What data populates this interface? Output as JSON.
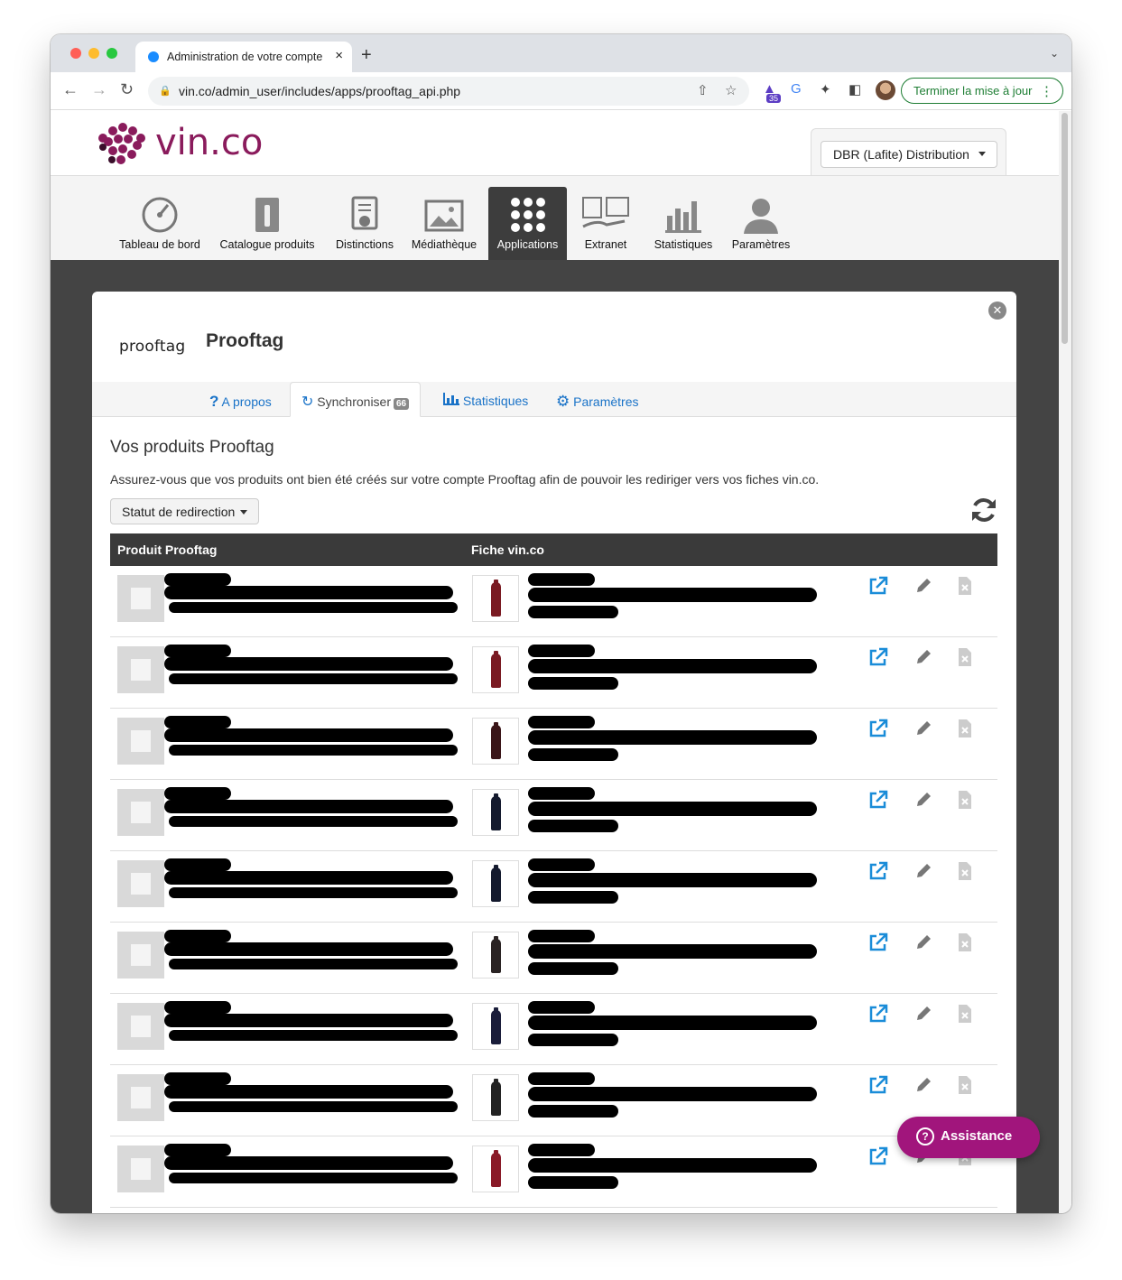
{
  "browser": {
    "tab_title": "Administration de votre compte",
    "url": "vin.co/admin_user/includes/apps/prooftag_api.php",
    "extension_badge": "35",
    "update_button": "Terminer la mise à jour"
  },
  "site": {
    "logo_text": "vin.co",
    "account_selector": "DBR (Lafite) Distribution"
  },
  "menu": {
    "items": [
      {
        "label": "Tableau de bord",
        "icon": "dashboard-icon"
      },
      {
        "label": "Catalogue produits",
        "icon": "catalog-icon"
      },
      {
        "label": "Distinctions",
        "icon": "certificate-icon"
      },
      {
        "label": "Médiathèque",
        "icon": "media-icon"
      },
      {
        "label": "Applications",
        "icon": "apps-icon",
        "active": true
      },
      {
        "label": "Extranet",
        "icon": "extranet-icon"
      },
      {
        "label": "Statistiques",
        "icon": "statistics-icon"
      },
      {
        "label": "Paramètres",
        "icon": "user-icon"
      }
    ]
  },
  "app": {
    "logo_text": "prooftag",
    "title": "Prooftag",
    "tabs": [
      {
        "label": "A propos",
        "icon": "question-icon"
      },
      {
        "label": "Synchroniser",
        "icon": "sync-icon",
        "badge": "66",
        "active": true
      },
      {
        "label": "Statistiques",
        "icon": "bar-chart-icon"
      },
      {
        "label": "Paramètres",
        "icon": "gear-icon"
      }
    ],
    "section_title": "Vos produits Prooftag",
    "description": "Assurez-vous que vos produits ont bien été créés sur votre compte Prooftag afin de pouvoir les rediriger vers vos fiches vin.co.",
    "filter_button": "Statut de redirection",
    "table": {
      "columns": [
        "Produit Prooftag",
        "Fiche vin.co"
      ],
      "rows": [
        {
          "bottle_color": "#7a1a22"
        },
        {
          "bottle_color": "#7a1a22"
        },
        {
          "bottle_color": "#3a1518"
        },
        {
          "bottle_color": "#141a2e"
        },
        {
          "bottle_color": "#141a2e"
        },
        {
          "bottle_color": "#2a2323"
        },
        {
          "bottle_color": "#1a1d3a"
        },
        {
          "bottle_color": "#232323"
        },
        {
          "bottle_color": "#8a1a28"
        }
      ]
    }
  },
  "assistance_button": "Assistance",
  "colors": {
    "brand": "#8a1b5c",
    "link": "#1a73c8",
    "assist": "#a1157c",
    "dark_bg": "#444444"
  }
}
